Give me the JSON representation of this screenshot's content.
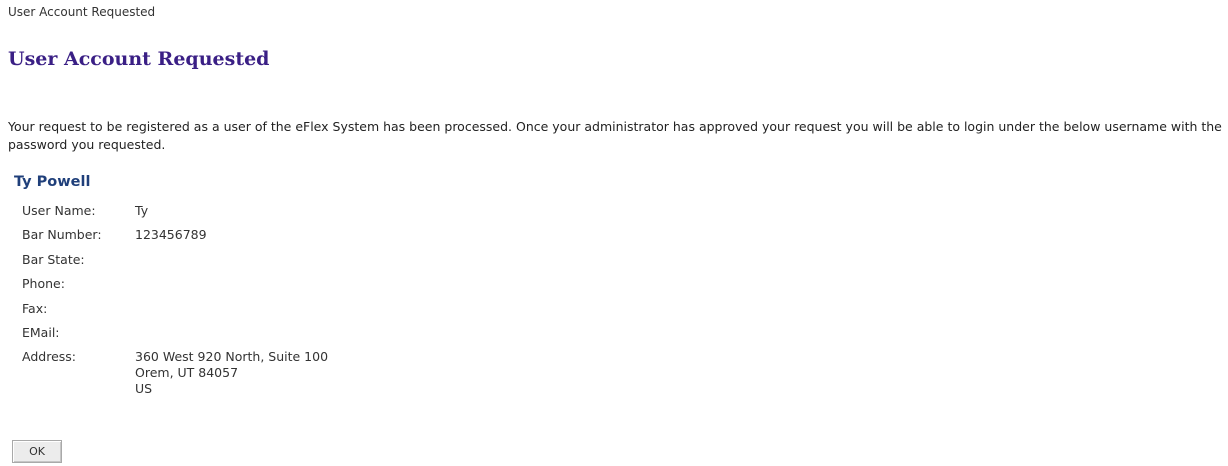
{
  "breadcrumb": {
    "text": "User Account Requested"
  },
  "page": {
    "title": "User Account Requested",
    "message": "Your request to be registered as a user of the eFlex System has been processed. Once your administrator has approved your request you will be able to login under the below username with the password you requested."
  },
  "user": {
    "full_name": "Ty Powell",
    "fields": {
      "user_name_label": "User Name:",
      "user_name_value": "Ty",
      "bar_number_label": "Bar Number:",
      "bar_number_value": "123456789",
      "bar_state_label": "Bar State:",
      "bar_state_value": "",
      "phone_label": "Phone:",
      "phone_value": "",
      "fax_label": "Fax:",
      "fax_value": "",
      "email_label": "EMail:",
      "email_value": "",
      "address_label": "Address:",
      "address_lines": [
        "360 West 920 North, Suite 100",
        "Orem, UT 84057",
        "US"
      ]
    }
  },
  "actions": {
    "ok_label": "OK"
  },
  "colors": {
    "title": "#3a1f85",
    "user_heading": "#1f3f7a"
  }
}
